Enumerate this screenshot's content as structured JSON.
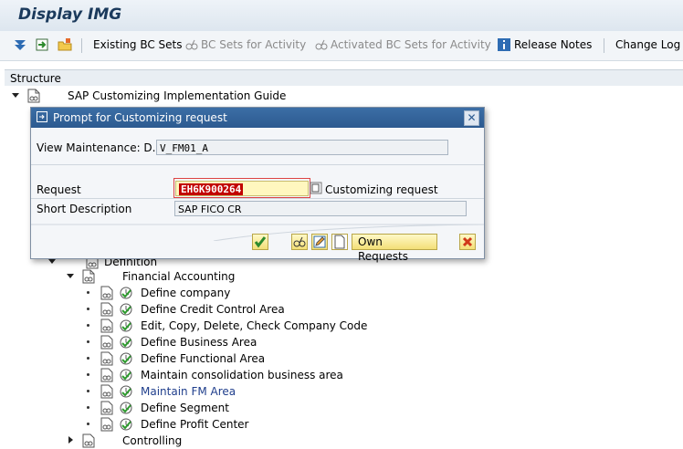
{
  "window": {
    "title": "Display IMG"
  },
  "toolbar": {
    "existing_bc_sets": "Existing BC Sets",
    "bc_sets_activity": "BC Sets for Activity",
    "activated_bc_sets": "Activated BC Sets for Activity",
    "release_notes": "Release Notes",
    "change_log": "Change Log"
  },
  "structure": {
    "header": "Structure",
    "root": "SAP Customizing Implementation Guide",
    "definition": "Definition",
    "financial_accounting": "Financial Accounting",
    "items": [
      "Define company",
      "Define Credit Control Area",
      "Edit, Copy, Delete, Check Company Code",
      "Define Business Area",
      "Define Functional Area",
      "Maintain consolidation business area",
      "Maintain FM Area",
      "Define Segment",
      "Define Profit Center"
    ],
    "controlling": "Controlling"
  },
  "dialog": {
    "title": "Prompt for Customizing request",
    "view_label": "View Maintenance: D...",
    "view_value": "V_FM01_A",
    "request_label": "Request",
    "request_value": "EH6K900264",
    "request_type": "Customizing request",
    "short_desc_label": "Short Description",
    "short_desc_value": "SAP FICO CR",
    "own_requests": "Own Requests"
  },
  "colors": {
    "title_blue": "#2c5a90",
    "accent_yellow": "#fff7bf",
    "selection_red": "#c20000"
  }
}
